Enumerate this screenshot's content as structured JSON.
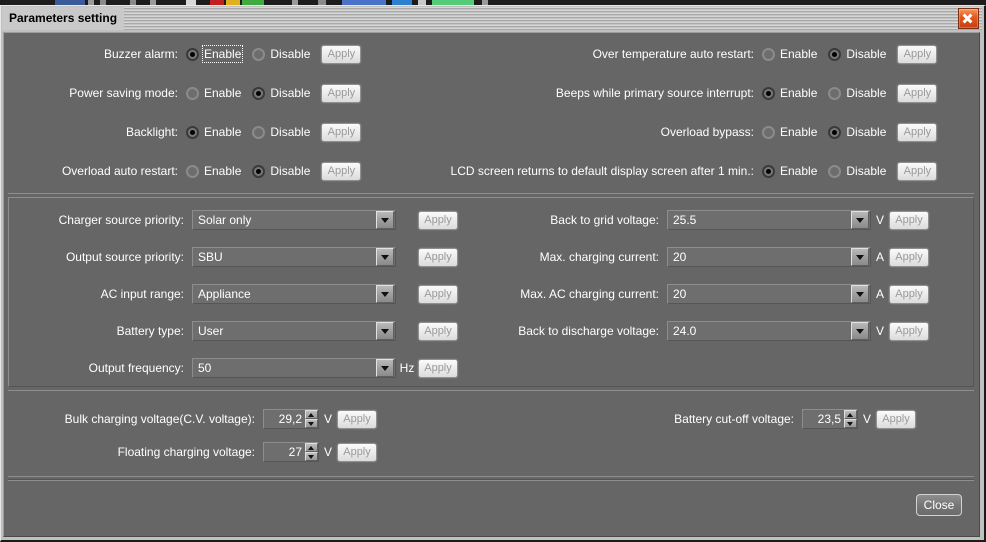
{
  "window": {
    "title": "Parameters setting",
    "close_icon": "close-x-icon"
  },
  "labels": {
    "enable": "Enable",
    "disable": "Disable",
    "apply": "Apply",
    "close": "Close"
  },
  "radio_settings": {
    "left": [
      {
        "label": "Buzzer alarm:",
        "selected": "enable",
        "focused": true
      },
      {
        "label": "Power saving mode:",
        "selected": "disable",
        "focused": false
      },
      {
        "label": "Backlight:",
        "selected": "enable",
        "focused": false
      },
      {
        "label": "Overload auto restart:",
        "selected": "disable",
        "focused": false
      }
    ],
    "right": [
      {
        "label": "Over temperature auto restart:",
        "selected": "disable",
        "focused": false
      },
      {
        "label": "Beeps while primary source interrupt:",
        "selected": "enable",
        "focused": false
      },
      {
        "label": "Overload bypass:",
        "selected": "disable",
        "focused": false
      },
      {
        "label": "LCD screen returns to default display screen after 1 min.:",
        "selected": "enable",
        "focused": false
      }
    ]
  },
  "combo_settings": {
    "left": [
      {
        "label": "Charger source priority:",
        "value": "Solar only",
        "unit": ""
      },
      {
        "label": "Output source priority:",
        "value": "SBU",
        "unit": ""
      },
      {
        "label": "AC input range:",
        "value": "Appliance",
        "unit": ""
      },
      {
        "label": "Battery type:",
        "value": "User",
        "unit": ""
      },
      {
        "label": "Output frequency:",
        "value": "50",
        "unit": "Hz"
      }
    ],
    "right": [
      {
        "label": "Back to grid voltage:",
        "value": "25.5",
        "unit": "V"
      },
      {
        "label": "Max. charging current:",
        "value": "20",
        "unit": "A"
      },
      {
        "label": "Max. AC charging current:",
        "value": "20",
        "unit": "A"
      },
      {
        "label": "Back to discharge voltage:",
        "value": "24.0",
        "unit": "V"
      }
    ]
  },
  "spinner_settings": {
    "left": [
      {
        "label": "Bulk charging voltage(C.V. voltage):",
        "value": "29,2",
        "unit": "V"
      },
      {
        "label": "Floating charging voltage:",
        "value": "27",
        "unit": "V"
      }
    ],
    "right": [
      {
        "label": "Battery cut-off voltage:",
        "value": "23,5",
        "unit": "V"
      }
    ]
  },
  "colors": {
    "window_chrome": "#c0c0c0",
    "client_bg": "#666666",
    "close_button_accent": "#e2591e",
    "text": "#ffffff"
  }
}
